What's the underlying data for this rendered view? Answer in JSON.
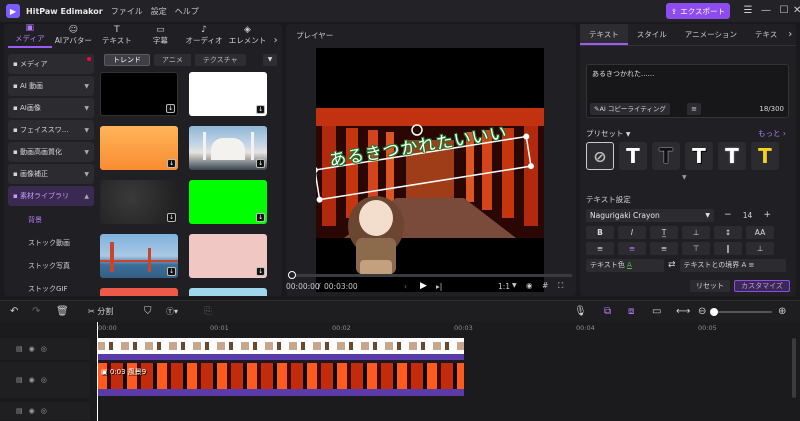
{
  "app": {
    "title": "HitPaw Edimakor",
    "menus": [
      "ファイル",
      "設定",
      "ヘルプ"
    ],
    "export_label": "エクスポート"
  },
  "colors": {
    "accent": "#8e4cf0",
    "panel": "#202024",
    "background": "#1a1a1d"
  },
  "tool_tabs": [
    {
      "label": "メディア",
      "icon": "folder-icon",
      "active": true
    },
    {
      "label": "AIアバター",
      "icon": "avatar-icon",
      "active": false
    },
    {
      "label": "テキスト",
      "icon": "text-icon",
      "active": false
    },
    {
      "label": "字幕",
      "icon": "caption-icon",
      "active": false
    },
    {
      "label": "オーディオ",
      "icon": "music-icon",
      "active": false
    },
    {
      "label": "エレメント",
      "icon": "element-icon",
      "active": false
    }
  ],
  "sidebar": [
    {
      "label": "メディア",
      "icon": "folder-icon",
      "badge": true
    },
    {
      "label": "AI 動画",
      "icon": "ai-video-icon"
    },
    {
      "label": "AI画像",
      "icon": "ai-image-icon"
    },
    {
      "label": "フェイススワ...",
      "icon": "face-swap-icon"
    },
    {
      "label": "動画高画質化",
      "icon": "enhance-icon"
    },
    {
      "label": "画像補正",
      "icon": "image-fix-icon"
    },
    {
      "label": "素材ライブラリ",
      "icon": "library-icon",
      "open": true
    }
  ],
  "library_sub": [
    "背景",
    "ストック動画",
    "ストック写真",
    "ストックGIF"
  ],
  "filter_chips": [
    "トレンド",
    "アニメ",
    "テクスチャ"
  ],
  "player": {
    "label": "プレイヤー",
    "time_current": "00:00:00",
    "time_total": "00:03:00",
    "ratio": "1:1",
    "overlay_text": "あるきつかれたいいい"
  },
  "right_tabs": [
    "テキスト",
    "スタイル",
    "アニメーション",
    "テキス"
  ],
  "text_panel": {
    "content": "あるきつかれた......",
    "ai_copy_label": "AI コピーライティング",
    "char_count": "18/300",
    "preset_label": "プリセット",
    "more_label": "もっと",
    "settings_label": "テキスト設定",
    "font_name": "Nagurigaki Crayon",
    "font_size": "14",
    "text_color_label": "テキスト色",
    "border_label": "テキストとの境界",
    "reset_label": "リセット",
    "customize_label": "カスタマイズ"
  },
  "timeline": {
    "split_label": "分割",
    "ruler": [
      "00:00",
      "00:01",
      "00:02",
      "00:03",
      "00:04",
      "00:05"
    ],
    "clip_label": "0:03 風景9"
  }
}
